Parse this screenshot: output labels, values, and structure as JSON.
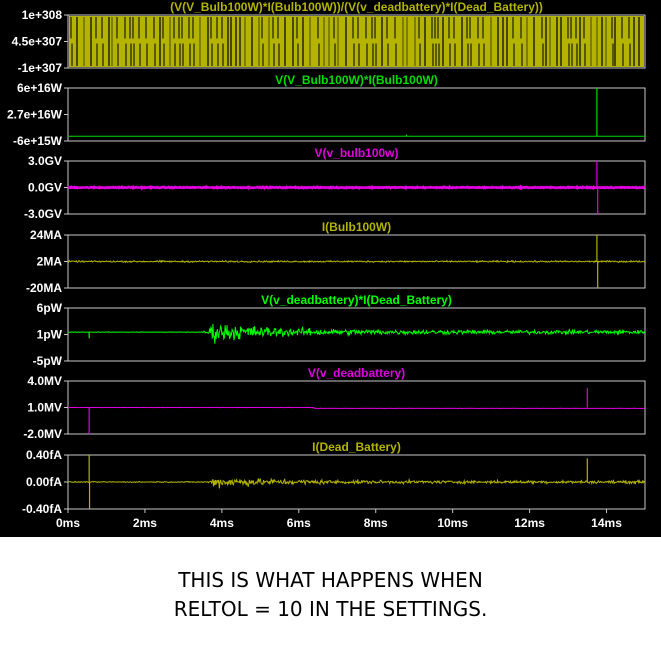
{
  "chart_data": {
    "type": "line",
    "x_axis": {
      "ticks": [
        "0ms",
        "2ms",
        "4ms",
        "6ms",
        "8ms",
        "10ms",
        "12ms",
        "14ms"
      ],
      "range_ms": [
        0,
        15
      ],
      "grid": false
    },
    "panels": [
      {
        "title": "(V(V_Bulb100W)*I(Bulb100W))/(V(v_deadbattery)*I(Dead_Battery))",
        "color": "#b3b300",
        "y_ticks": [
          "1e+308",
          "4.5e+307",
          "-1e+307"
        ],
        "ylim": [
          -1e+307,
          1e+308
        ],
        "style": "dense_bars"
      },
      {
        "title": "V(V_Bulb100W)*I(Bulb100W)",
        "color": "#00dd00",
        "y_ticks": [
          "6e+16W",
          "2.7e+16W",
          "-6e+15W"
        ],
        "ylim": [
          -6000000000000000.0,
          6e+16
        ],
        "baseline": 0,
        "noise": 0.004,
        "spikes": [
          {
            "x": 8.8,
            "y": 2000000000000000.0
          },
          {
            "x": 13.75,
            "y": 6e+16
          }
        ]
      },
      {
        "title": "V(v_bulb100w)",
        "color": "#e000e0",
        "y_ticks": [
          "3.0GV",
          "0.0GV",
          "-3.0GV"
        ],
        "ylim": [
          -3.0,
          3.0
        ],
        "baseline": 0.0,
        "noise": 0.09,
        "thick": true,
        "spikes": [
          {
            "x": 13.75,
            "y": 3.0
          },
          {
            "x": 13.77,
            "y": -3.0
          }
        ]
      },
      {
        "title": "I(Bulb100W)",
        "color": "#b3b300",
        "y_ticks": [
          "24MA",
          "2MA",
          "-20MA"
        ],
        "ylim": [
          -20,
          24
        ],
        "baseline": 2,
        "noise": 0.9,
        "spikes": [
          {
            "x": 13.75,
            "y": 24
          },
          {
            "x": 13.77,
            "y": -20
          }
        ]
      },
      {
        "title": "V(v_deadbattery)*I(Dead_Battery)",
        "color": "#00ff00",
        "y_ticks": [
          "6pW",
          "1pW",
          "-5pW"
        ],
        "ylim": [
          -5,
          6
        ],
        "baseline": 1,
        "noise": 0.06,
        "burst_start": 3.5,
        "burst_peak": 3.8,
        "burst_amp": 3.0,
        "decay_to": 0.6,
        "spikes": [
          {
            "x": 0.55,
            "y": -0.3
          }
        ]
      },
      {
        "title": "V(v_deadbattery)",
        "color": "#e000e0",
        "y_ticks": [
          "4.0MV",
          "1.0MV",
          "-2.0MV"
        ],
        "ylim": [
          -2.0,
          4.0
        ],
        "baseline": 1.0,
        "noise": 0.02,
        "step_at": 6.4,
        "step_to": 0.9,
        "spikes": [
          {
            "x": 0.55,
            "y": -2.0
          },
          {
            "x": 13.5,
            "y": 3.2
          }
        ]
      },
      {
        "title": "I(Dead_Battery)",
        "color": "#b3b300",
        "y_ticks": [
          "0.40fA",
          "0.00fA",
          "-0.40fA"
        ],
        "ylim": [
          -0.4,
          0.4
        ],
        "baseline": 0.0,
        "noise": 0.01,
        "burst_start": 3.6,
        "burst_peak": 3.85,
        "burst_amp": 0.12,
        "decay_to": 0.03,
        "spikes": [
          {
            "x": 0.55,
            "y": 0.4
          },
          {
            "x": 0.56,
            "y": -0.4
          },
          {
            "x": 13.5,
            "y": 0.35
          }
        ]
      }
    ]
  },
  "caption": {
    "line1": "THIS IS WHAT HAPPENS WHEN",
    "line2": "RELTOL = 10 IN THE SETTINGS."
  }
}
